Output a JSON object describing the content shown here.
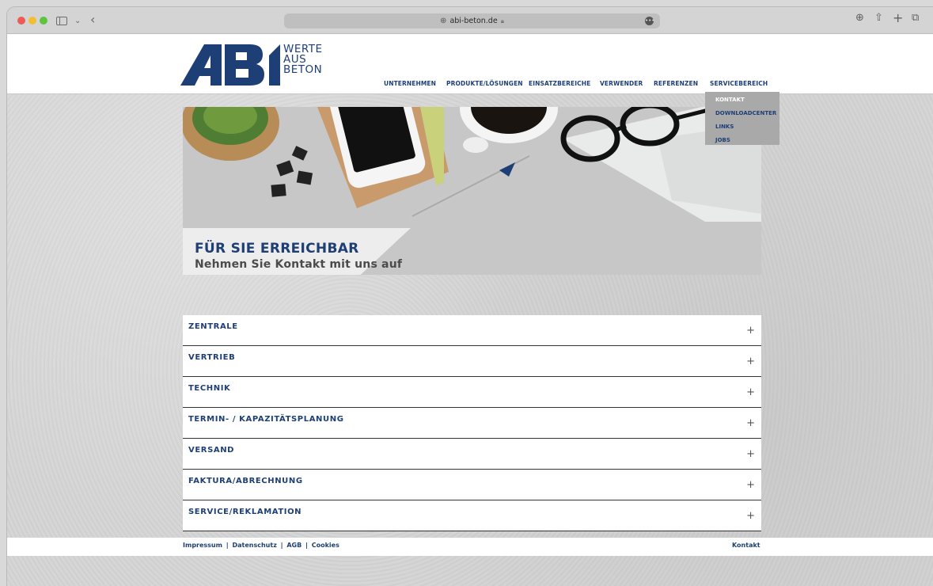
{
  "browser": {
    "url": "abi-beton.de",
    "icons": [
      "sidebar-icon",
      "chevron-down-icon",
      "back-arrow-icon",
      "globe-icon",
      "lock-icon",
      "menu-icon",
      "download-icon",
      "share-icon",
      "plus-icon",
      "tabs-icon"
    ]
  },
  "logo": {
    "mark": "ABI",
    "line1": "WERTE",
    "line2": "AUS",
    "line3": "BETON"
  },
  "nav": {
    "items": [
      "UNTERNEHMEN",
      "PRODUKTE/LÖSUNGEN",
      "EINSATZBEREICHE",
      "VERWENDER",
      "REFERENZEN",
      "SERVICEBEREICH"
    ],
    "dropdown": [
      "KONTAKT",
      "DOWNLOADCENTER",
      "LINKS",
      "JOBS"
    ]
  },
  "hero": {
    "title": "FÜR SIE ERREICHBAR",
    "subtitle": "Nehmen Sie Kontakt mit uns auf"
  },
  "accordion": {
    "items": [
      {
        "label": "ZENTRALE",
        "toggle": "+"
      },
      {
        "label": "VERTRIEB",
        "toggle": "+"
      },
      {
        "label": "TECHNIK",
        "toggle": "+"
      },
      {
        "label": "TERMIN- / KAPAZITÄTSPLANUNG",
        "toggle": "+"
      },
      {
        "label": "VERSAND",
        "toggle": "+"
      },
      {
        "label": "FAKTURA/ABRECHNUNG",
        "toggle": "+"
      },
      {
        "label": "SERVICE/REKLAMATION",
        "toggle": "+"
      }
    ]
  },
  "footer": {
    "links": [
      "Impressum",
      "Datenschutz",
      "AGB",
      "Cookies"
    ],
    "separator": "|",
    "contact": "Kontakt"
  },
  "colors": {
    "brand": "#1e3f75",
    "dropdown_bg": "#a9a9a9",
    "dropdown_active": "#ffffff"
  }
}
